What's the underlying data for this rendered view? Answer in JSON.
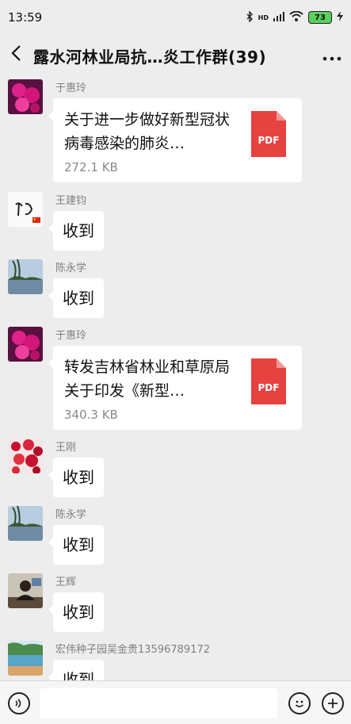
{
  "status": {
    "time": "13:59",
    "network": "HD",
    "battery": "73"
  },
  "header": {
    "title": "露水河林业局抗…炎工作群(39)",
    "back_icon": "chevron-left-icon",
    "more_icon": "ellipsis-icon"
  },
  "messages": [
    {
      "sender": "于惠玲",
      "type": "file",
      "file_name": "关于进一步做好新型冠状病毒感染的肺炎…",
      "file_size": "272.1 KB",
      "file_type": "PDF",
      "avatar": "pink-orchid"
    },
    {
      "sender": "王建钧",
      "type": "text",
      "text": "收到",
      "avatar": "calligraphy-flag"
    },
    {
      "sender": "陈永学",
      "type": "text",
      "text": "收到",
      "avatar": "lake-willow"
    },
    {
      "sender": "于惠玲",
      "type": "file",
      "file_name": "转发吉林省林业和草原局关于印发《新型…",
      "file_size": "340.3 KB",
      "file_type": "PDF",
      "avatar": "pink-orchid"
    },
    {
      "sender": "王刚",
      "type": "text",
      "text": "收到",
      "avatar": "red-flowers"
    },
    {
      "sender": "陈永学",
      "type": "text",
      "text": "收到",
      "avatar": "lake-willow"
    },
    {
      "sender": "王辉",
      "type": "text",
      "text": "收到",
      "avatar": "person-desk"
    },
    {
      "sender": "宏伟种子园吴金贵13596789172",
      "type": "text",
      "text": "收到",
      "avatar": "garden-pool"
    }
  ],
  "colors": {
    "background": "#ededed",
    "bubble": "#ffffff",
    "pdf": "#e64340",
    "sender": "#808080"
  },
  "input_bar": {
    "voice_icon": "voice-icon",
    "emoji_icon": "emoji-icon",
    "plus_icon": "plus-icon"
  }
}
